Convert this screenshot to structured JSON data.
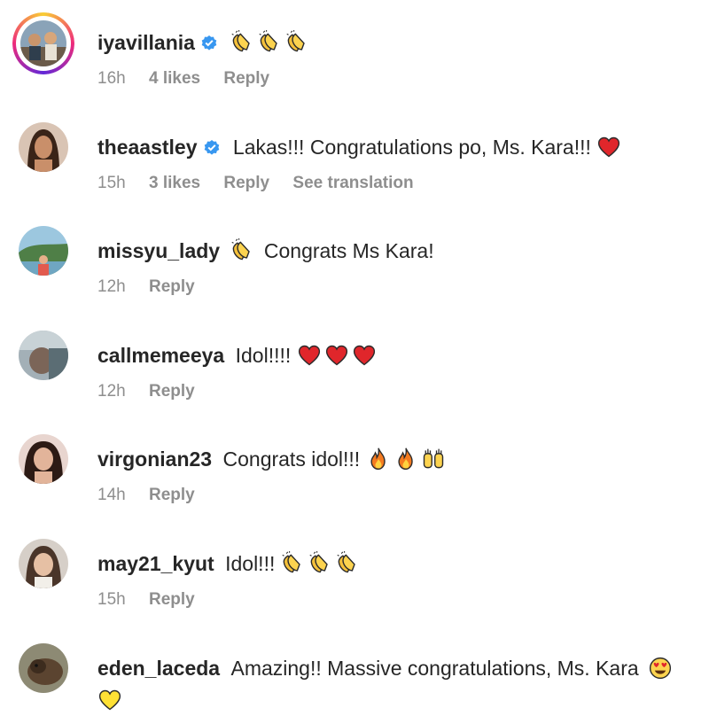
{
  "comments": [
    {
      "username": "iyavillania",
      "verified": true,
      "text": "",
      "emojis": [
        "clapping-hands",
        "clapping-hands",
        "clapping-hands"
      ],
      "time": "16h",
      "likes": "4 likes",
      "reply": "Reply",
      "translation": ""
    },
    {
      "username": "theaastley",
      "verified": true,
      "text": "Lakas!!! Congratulations po, Ms. Kara!!!",
      "emojis": [
        "red-heart"
      ],
      "time": "15h",
      "likes": "3 likes",
      "reply": "Reply",
      "translation": "See translation"
    },
    {
      "username": "missyu_lady",
      "verified": false,
      "text": "Congrats Ms Kara!",
      "emojis": [
        "clapping-hands"
      ],
      "time": "12h",
      "likes": "",
      "reply": "Reply",
      "translation": ""
    },
    {
      "username": "callmemeeya",
      "verified": false,
      "text": "Idol!!!!",
      "emojis": [
        "red-heart",
        "red-heart",
        "red-heart"
      ],
      "time": "12h",
      "likes": "",
      "reply": "Reply",
      "translation": ""
    },
    {
      "username": "virgonian23",
      "verified": false,
      "text": "Congrats idol!!!",
      "emojis": [
        "fire",
        "fire",
        "raising-hands"
      ],
      "time": "14h",
      "likes": "",
      "reply": "Reply",
      "translation": ""
    },
    {
      "username": "may21_kyut",
      "verified": false,
      "text": "Idol!!!",
      "emojis": [
        "clapping-hands",
        "clapping-hands",
        "clapping-hands"
      ],
      "time": "15h",
      "likes": "",
      "reply": "Reply",
      "translation": ""
    },
    {
      "username": "eden_laceda",
      "verified": false,
      "text": "Amazing!! Massive congratulations, Ms. Kara",
      "emojis": [
        "heart-eyes-face"
      ],
      "emojis_line2": [
        "yellow-heart"
      ],
      "time": "",
      "likes": "",
      "reply": "",
      "translation": ""
    }
  ],
  "colors": {
    "verified": "#3897f0",
    "meta": "#8e8e8e",
    "text": "#262626"
  }
}
